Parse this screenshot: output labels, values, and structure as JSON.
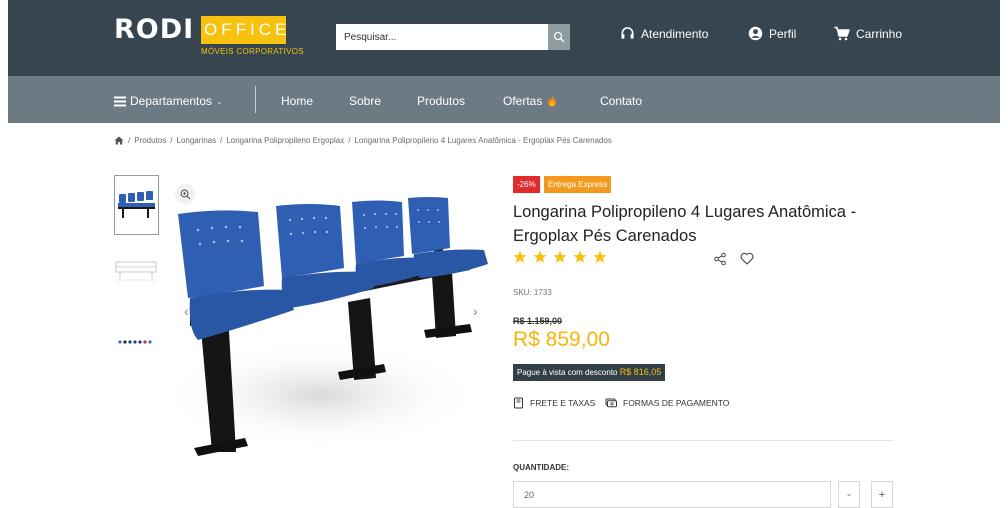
{
  "header": {
    "logo_main": "RODI",
    "logo_office": "OFFICE",
    "logo_sub": "MÓVEIS CORPORATIVOS",
    "search_placeholder": "Pesquisar...",
    "atendimento": "Atendimento",
    "perfil": "Perfil",
    "carrinho": "Carrinho"
  },
  "nav": {
    "departamentos": "Departamentos",
    "items": [
      "Home",
      "Sobre",
      "Produtos",
      "Ofertas",
      "Contato"
    ]
  },
  "breadcrumb": [
    "Produtos",
    "Longarinas",
    "Longarina Polipropileno Ergoplax",
    "Longarina Polipropileno 4 Lugares Anatômica - Ergoplax Pés Carenados"
  ],
  "product": {
    "discount_badge": "-26%",
    "express_badge": "Entrega Express",
    "title": "Longarina Polipropileno 4 Lugares Anatômica - Ergoplax Pés Carenados",
    "rating": 5,
    "sku_label": "SKU:",
    "sku": "1733",
    "old_price": "R$ 1.159,00",
    "price": "R$ 859,00",
    "pix_text": "Pague à vista com desconto",
    "pix_price": "R$ 816,05",
    "frete": "FRETE E TAXAS",
    "formas": "FORMAS DE PAGAMENTO",
    "quantity_label": "QUANTIDADE:",
    "quantity": "20",
    "minus": "-",
    "plus": "+"
  },
  "colors": {
    "header_bg": "#36454f",
    "nav_bg": "#6c7a83",
    "accent": "#f6c20f",
    "discount": "#e02b2b",
    "express": "#f39a1e",
    "chair_blue": "#2f5fb3"
  }
}
